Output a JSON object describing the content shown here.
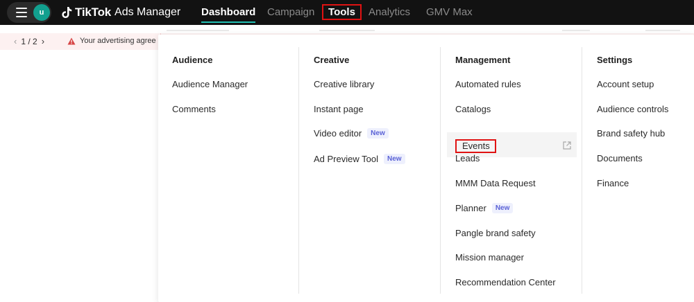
{
  "topbar": {
    "avatar_letter": "u",
    "brand_main": "TikTok",
    "brand_sub": "Ads Manager",
    "nav": {
      "dashboard": "Dashboard",
      "campaign": "Campaign",
      "tools": "Tools",
      "analytics": "Analytics",
      "gmv_max": "GMV Max"
    }
  },
  "notice": {
    "pager": "1 / 2",
    "text": "Your advertising agree"
  },
  "menu": {
    "audience": {
      "title": "Audience",
      "items": [
        "Audience Manager",
        "Comments"
      ]
    },
    "creative": {
      "title": "Creative",
      "items": [
        "Creative library",
        "Instant page",
        "Video editor",
        "Ad Preview Tool"
      ],
      "badge": "New"
    },
    "management": {
      "title": "Management",
      "items": [
        "Automated rules",
        "Catalogs",
        "Events",
        "Leads",
        "MMM Data Request",
        "Planner",
        "Pangle brand safety",
        "Mission manager",
        "Recommendation Center"
      ],
      "badge": "New"
    },
    "settings": {
      "title": "Settings",
      "items": [
        "Account setup",
        "Audience controls",
        "Brand safety hub",
        "Documents",
        "Finance"
      ]
    }
  },
  "icons": {
    "menu": "hamburger-icon",
    "logo": "tiktok-logo-icon",
    "prev": "chevron-left-icon",
    "next": "chevron-right-icon",
    "warning": "warning-icon",
    "external": "external-link-icon"
  },
  "colors": {
    "topbar_bg": "#121212",
    "accent_teal": "#22c1b4",
    "highlight_red": "#e01212",
    "badge_bg": "#eef0fd",
    "badge_text": "#5a62d6",
    "notice_bg": "#fdf1f1"
  }
}
